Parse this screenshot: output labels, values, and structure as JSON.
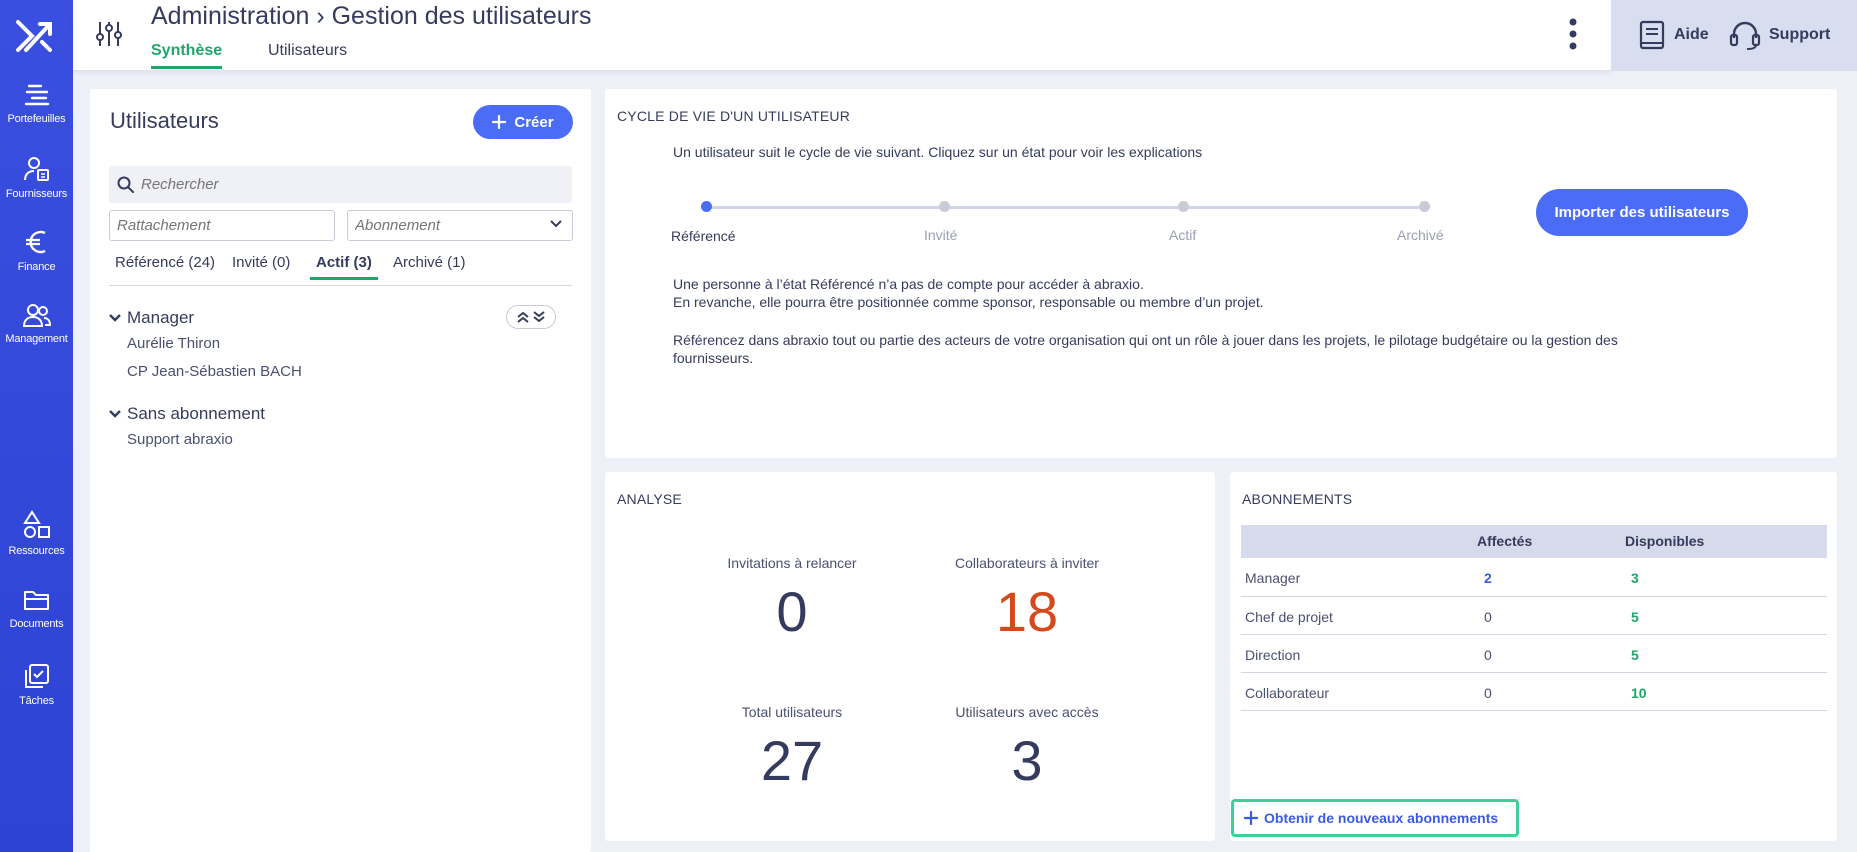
{
  "nav": {
    "items": [
      {
        "label": "Portefeuilles",
        "icon": "portfolio-icon"
      },
      {
        "label": "Fournisseurs",
        "icon": "supplier-icon"
      },
      {
        "label": "Finance",
        "icon": "euro-icon"
      },
      {
        "label": "Management",
        "icon": "people-icon"
      },
      {
        "label": "Ressources",
        "icon": "shapes-icon"
      },
      {
        "label": "Documents",
        "icon": "folder-icon"
      },
      {
        "label": "Tâches",
        "icon": "tasks-icon"
      }
    ]
  },
  "header": {
    "title": "Administration › Gestion des utilisateurs",
    "tabs": [
      {
        "label": "Synthèse",
        "active": true
      },
      {
        "label": "Utilisateurs",
        "active": false
      }
    ],
    "help_label": "Aide",
    "support_label": "Support"
  },
  "users_panel": {
    "title": "Utilisateurs",
    "create_label": "Créer",
    "search_placeholder": "Rechercher",
    "rattachement_placeholder": "Rattachement",
    "abonnement_placeholder": "Abonnement",
    "status_tabs": [
      {
        "label": "Référencé (24)",
        "active": false
      },
      {
        "label": "Invité (0)",
        "active": false
      },
      {
        "label": "Actif (3)",
        "active": true
      },
      {
        "label": "Archivé (1)",
        "active": false
      }
    ],
    "groups": [
      {
        "name": "Manager",
        "members": [
          "Aurélie Thiron",
          "CP Jean-Sébastien BACH"
        ]
      },
      {
        "name": "Sans abonnement",
        "members": [
          "Support abraxio"
        ]
      }
    ]
  },
  "lifecycle": {
    "title": "CYCLE DE VIE D'UN UTILISATEUR",
    "intro": "Un utilisateur suit le cycle de vie suivant. Cliquez sur un état pour voir les explications",
    "states": [
      "Référencé",
      "Invité",
      "Actif",
      "Archivé"
    ],
    "active_state": "Référencé",
    "import_label": "Importer des utilisateurs",
    "description": [
      "Une personne à l’état Référencé n’a pas de compte pour accéder à abraxio.",
      "En revanche, elle pourra être positionnée comme sponsor, responsable ou membre d’un projet.",
      "Référencez dans abraxio tout ou partie des acteurs de votre organisation qui ont un rôle à jouer dans les projets, le pilotage budgétaire ou la gestion des",
      "fournisseurs."
    ]
  },
  "analyse": {
    "title": "ANALYSE",
    "stats": [
      {
        "label": "Invitations à relancer",
        "value": "0"
      },
      {
        "label": "Collaborateurs à inviter",
        "value": "18"
      },
      {
        "label": "Total utilisateurs",
        "value": "27"
      },
      {
        "label": "Utilisateurs avec accès",
        "value": "3"
      }
    ]
  },
  "abonnements": {
    "title": "ABONNEMENTS",
    "columns": [
      "",
      "Affectés",
      "Disponibles"
    ],
    "rows": [
      {
        "name": "Manager",
        "affectes": "2",
        "disponibles": "3"
      },
      {
        "name": "Chef de projet",
        "affectes": "0",
        "disponibles": "5"
      },
      {
        "name": "Direction",
        "affectes": "0",
        "disponibles": "5"
      },
      {
        "name": "Collaborateur",
        "affectes": "0",
        "disponibles": "10"
      }
    ],
    "link_label": "Obtenir de nouveaux abonnements"
  }
}
